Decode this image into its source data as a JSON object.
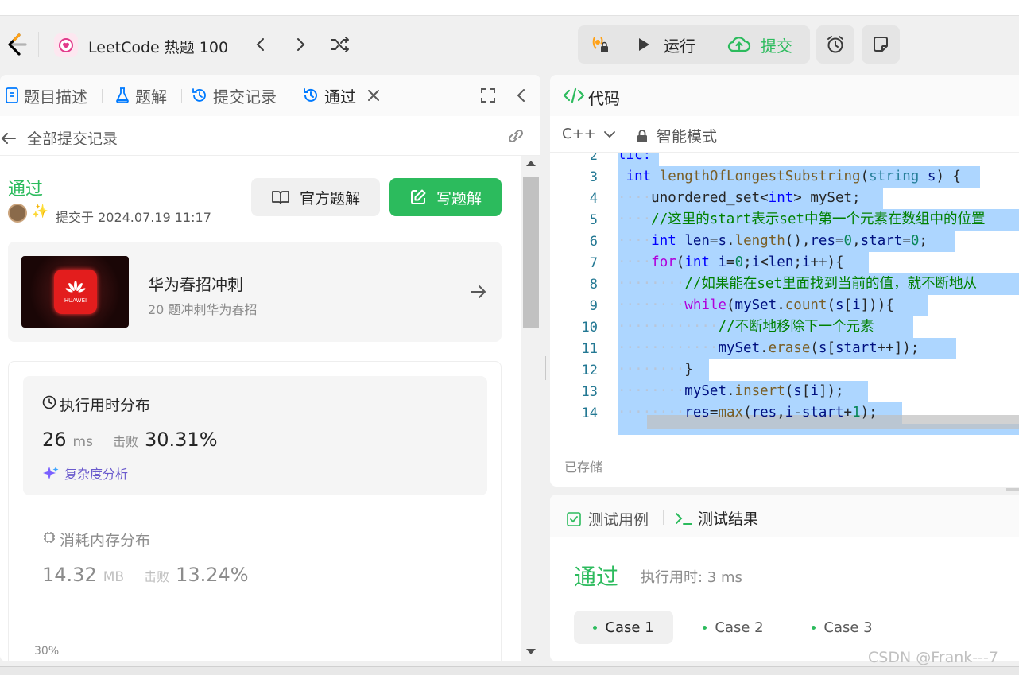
{
  "header": {
    "title": "LeetCode 热题 100",
    "run_label": "运行",
    "submit_label": "提交"
  },
  "left": {
    "tabs": [
      {
        "label": "题目描述"
      },
      {
        "label": "题解"
      },
      {
        "label": "提交记录"
      },
      {
        "label": "通过"
      }
    ],
    "back_label": "全部提交记录",
    "status": "通过",
    "submitted_at": "提交于 2024.07.19 11:17",
    "official_solution_label": "官方题解",
    "write_solution_label": "写题解",
    "promo": {
      "title": "华为春招冲刺",
      "subtitle": "20 题冲刺华为春招",
      "badge_text": "HUAWEI"
    },
    "runtime": {
      "title": "执行用时分布",
      "value": "26",
      "unit": "ms",
      "beats_label": "击败",
      "beats_value": "30.31%",
      "analysis_label": "复杂度分析"
    },
    "memory": {
      "title": "消耗内存分布",
      "value": "14.32",
      "unit": "MB",
      "beats_label": "击败",
      "beats_value": "13.24%"
    },
    "chart_axis_label": "30%"
  },
  "code": {
    "title": "代码",
    "language": "C++",
    "mode": "智能模式",
    "saved_label": "已存储",
    "line_numbers": [
      "2",
      "3",
      "4",
      "5",
      "6",
      "7",
      "8",
      "9",
      "10",
      "11",
      "12",
      "13",
      "14"
    ]
  },
  "test": {
    "tab_cases": "测试用例",
    "tab_results": "测试结果",
    "status": "通过",
    "runtime": "执行用时: 3 ms",
    "cases": [
      "Case 1",
      "Case 2",
      "Case 3"
    ]
  },
  "watermark": "CSDN @Frank---7",
  "colors": {
    "accent_green": "#2cbb5d",
    "link_blue": "#007aff",
    "orange": "#ffa116"
  }
}
